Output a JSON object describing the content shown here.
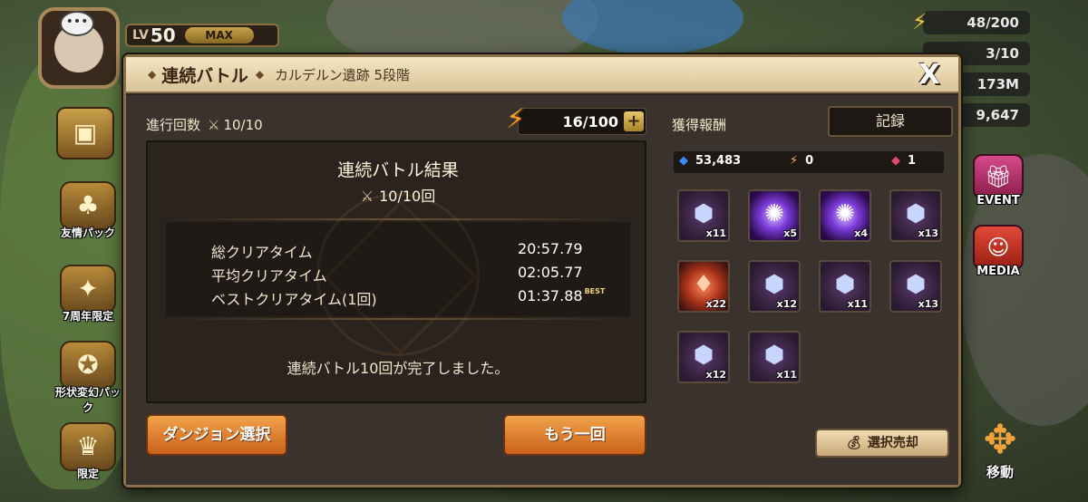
{
  "hud": {
    "lv_label": "LV",
    "level": "50",
    "max_label": "MAX",
    "chat_icon": "•••",
    "resources": [
      {
        "icon": "energy-bolt-icon",
        "value": "48/200"
      },
      {
        "icon": "arena-wing-icon",
        "value": "3/10"
      },
      {
        "icon": "mana-icon",
        "value": "173M"
      },
      {
        "icon": "crystal-icon",
        "value": "9,647"
      }
    ]
  },
  "side_menu": {
    "items": [
      {
        "label": "友情パック"
      },
      {
        "label": "7周年限定"
      },
      {
        "label": "形状変幻パック"
      },
      {
        "label": "限定"
      }
    ]
  },
  "right_menu": {
    "event_label": "EVENT",
    "media_label": "MEDIA",
    "move_label": "移動"
  },
  "modal": {
    "title": "連続バトル",
    "subtitle": "カルデルン遺跡 5段階",
    "close_symbol": "X",
    "progress_label": "進行回数",
    "progress_value": "10/10",
    "energy_value": "16/100",
    "energy_plus": "+",
    "result": {
      "title": "連続バトル結果",
      "count": "10/10回",
      "rows": [
        {
          "label": "総クリアタイム",
          "value": "20:57.79"
        },
        {
          "label": "平均クリアタイム",
          "value": "02:05.77"
        },
        {
          "label": "ベストクリアタイム(1回)",
          "value": "01:37.88",
          "badge": "BEST"
        }
      ],
      "message": "連続バトル10回が完了しました。"
    },
    "buttons": {
      "dungeon_select": "ダンジョン選択",
      "again": "もう一回"
    },
    "rewards": {
      "label": "獲得報酬",
      "record_button": "記録",
      "summary": [
        {
          "icon": "crystal-icon",
          "value": "53,483"
        },
        {
          "icon": "energy-bolt-icon",
          "value": "0"
        },
        {
          "icon": "ruby-icon",
          "value": "1"
        }
      ],
      "items": [
        {
          "type": "rune",
          "count": "x11"
        },
        {
          "type": "orb",
          "count": "x5"
        },
        {
          "type": "orb",
          "count": "x4"
        },
        {
          "type": "rune",
          "count": "x13"
        },
        {
          "type": "crystal",
          "count": "x22"
        },
        {
          "type": "rune",
          "count": "x12"
        },
        {
          "type": "rune",
          "count": "x11"
        },
        {
          "type": "rune",
          "count": "x13"
        },
        {
          "type": "rune",
          "count": "x12"
        },
        {
          "type": "rune",
          "count": "x11"
        }
      ],
      "sell_button": "選択売却"
    }
  }
}
